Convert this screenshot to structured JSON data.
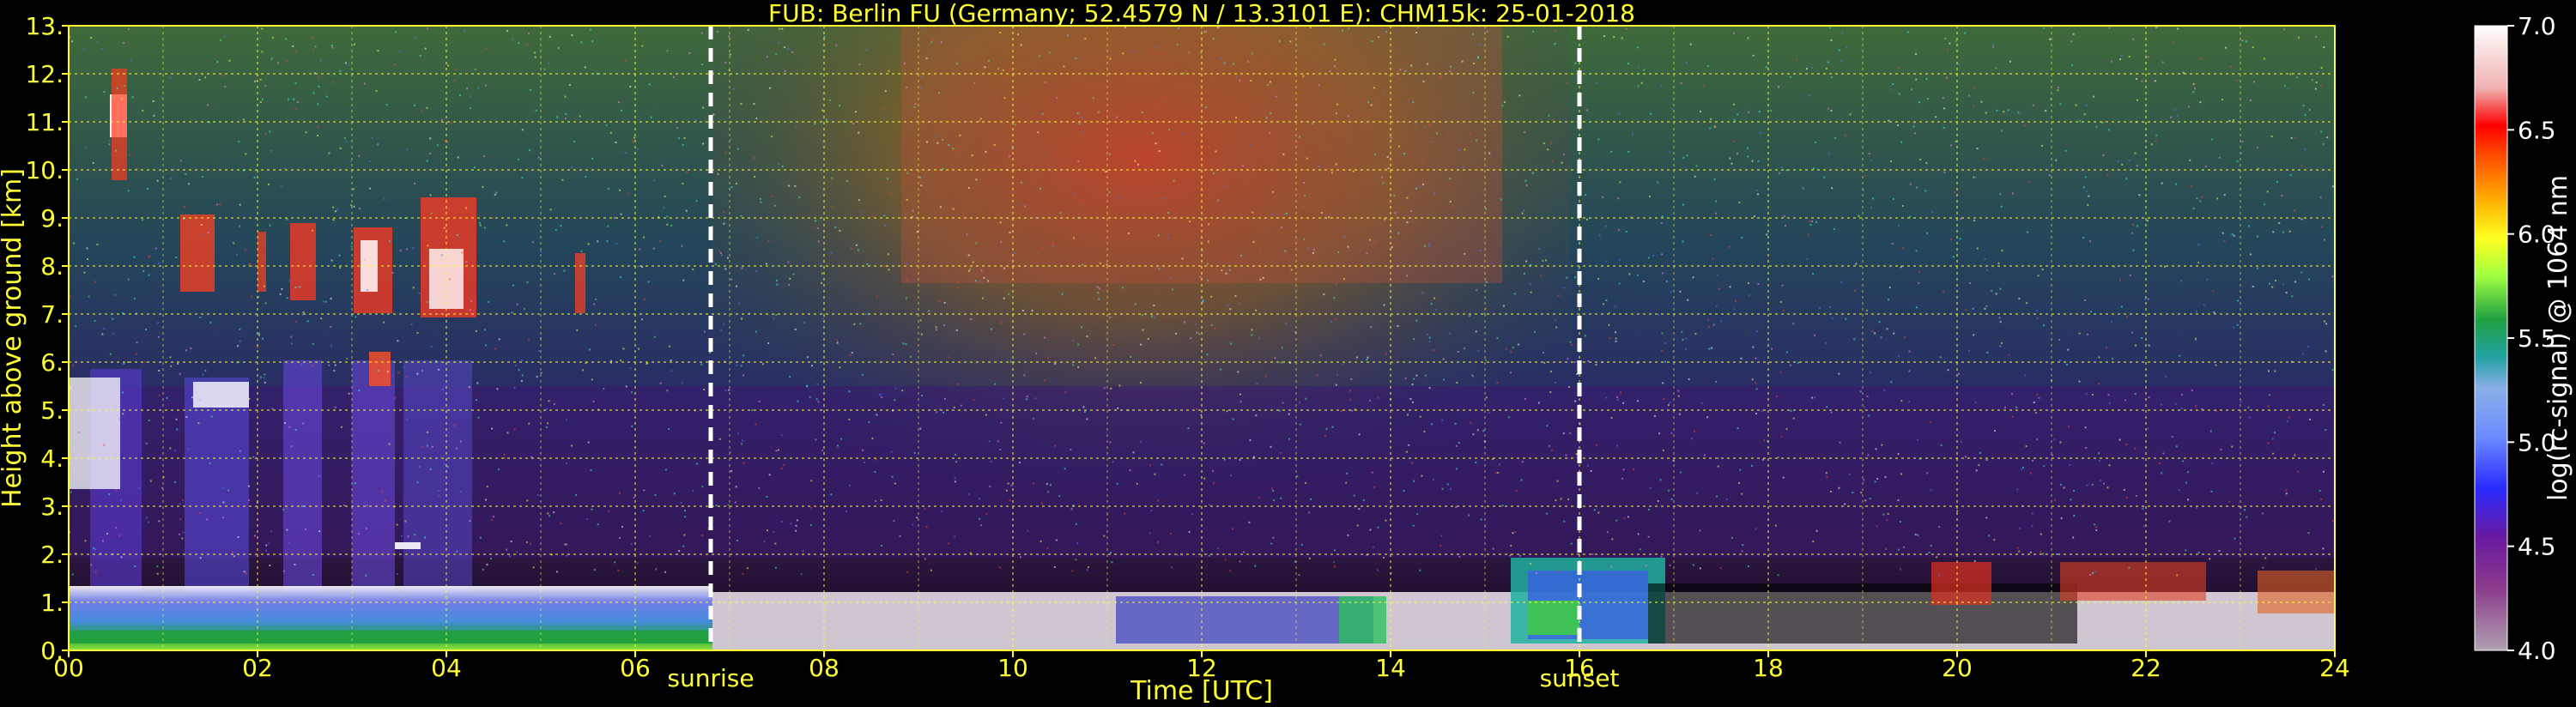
{
  "chart_data": {
    "type": "heatmap",
    "title": "FUB: Berlin FU (Germany; 52.4579 N / 13.3101 E):    CHM15k: 25-01-2018",
    "xlabel": "Time [UTC]",
    "ylabel": "Height above ground [km]",
    "xlim": [
      0,
      24
    ],
    "ylim": [
      0,
      13
    ],
    "x_ticks": [
      "00",
      "02",
      "04",
      "06",
      "08",
      "10",
      "12",
      "14",
      "16",
      "18",
      "20",
      "22",
      "24"
    ],
    "y_ticks": [
      "0.",
      "1.",
      "2.",
      "3.",
      "4.",
      "5.",
      "6.",
      "7.",
      "8.",
      "9.",
      "10.",
      "11.",
      "12.",
      "13."
    ],
    "grid": true,
    "annotations": [
      {
        "label": "sunrise",
        "x": 6.8
      },
      {
        "label": "sunset",
        "x": 16.0
      }
    ],
    "colorbar": {
      "label": "log(rc-signal) @ 1064 nm",
      "range": [
        4.0,
        7.0
      ],
      "ticks": [
        "4.0",
        "4.5",
        "5.0",
        "5.5",
        "6.0",
        "6.5",
        "7.0"
      ]
    },
    "features": [
      {
        "name": "boundary-layer",
        "x": [
          0,
          24
        ],
        "top_km": 1.2
      },
      {
        "name": "cirrus-clouds",
        "x": [
          0.3,
          5.6
        ],
        "height_km": [
          7,
          11.5
        ]
      },
      {
        "name": "afternoon-layer",
        "x": [
          15.2,
          16.8
        ],
        "height_km": [
          0,
          1.6
        ]
      }
    ]
  }
}
